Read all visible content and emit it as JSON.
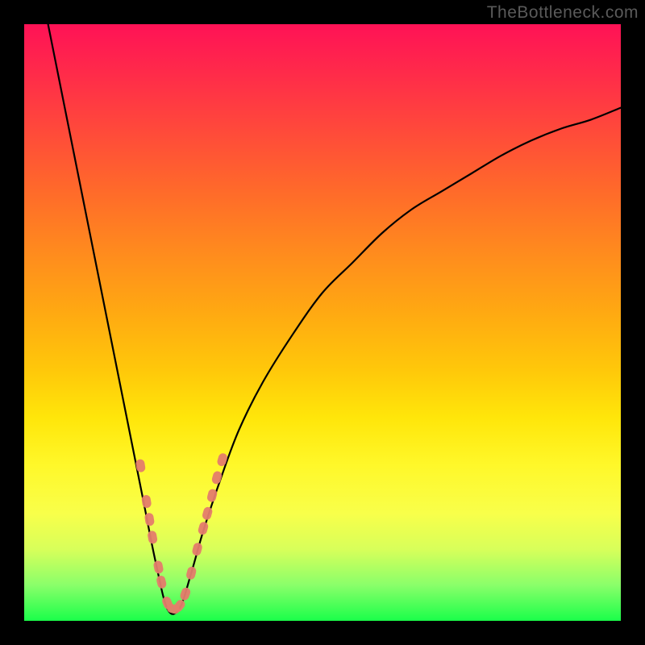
{
  "watermark": "TheBottleneck.com",
  "colors": {
    "background_frame": "#000000",
    "curve_stroke": "#000000",
    "marker_fill": "#e47c6c",
    "marker_stroke": "#e47c6c",
    "gradient_top": "#ff1256",
    "gradient_mid": "#ffe60a",
    "gradient_bottom": "#1aff4a"
  },
  "chart_data": {
    "type": "line",
    "title": "",
    "xlabel": "",
    "ylabel": "",
    "xlim": [
      0,
      100
    ],
    "ylim": [
      0,
      100
    ],
    "legend": false,
    "grid": false,
    "note": "V-shaped bottleneck curve. X = relative component power (arbitrary 0-100), Y = bottleneck severity percent (0 = none, 100 = full). Minimum near x≈24.",
    "series": [
      {
        "name": "bottleneck-curve",
        "values": [
          [
            4,
            100
          ],
          [
            6,
            90
          ],
          [
            8,
            80
          ],
          [
            10,
            70
          ],
          [
            12,
            60
          ],
          [
            14,
            50
          ],
          [
            16,
            40
          ],
          [
            18,
            30
          ],
          [
            20,
            20
          ],
          [
            22,
            10
          ],
          [
            24,
            2
          ],
          [
            26,
            2
          ],
          [
            28,
            8
          ],
          [
            30,
            15
          ],
          [
            33,
            24
          ],
          [
            36,
            32
          ],
          [
            40,
            40
          ],
          [
            45,
            48
          ],
          [
            50,
            55
          ],
          [
            55,
            60
          ],
          [
            60,
            65
          ],
          [
            65,
            69
          ],
          [
            70,
            72
          ],
          [
            75,
            75
          ],
          [
            80,
            78
          ],
          [
            85,
            80.5
          ],
          [
            90,
            82.5
          ],
          [
            95,
            84
          ],
          [
            100,
            86
          ]
        ]
      }
    ],
    "markers": {
      "name": "highlighted-points",
      "note": "Salmon pill-shaped markers clustered near curve bottom on both arms.",
      "values": [
        [
          19.5,
          26
        ],
        [
          20.5,
          20
        ],
        [
          21,
          17
        ],
        [
          21.5,
          14
        ],
        [
          22.5,
          9
        ],
        [
          23,
          6.5
        ],
        [
          24,
          3
        ],
        [
          25,
          2
        ],
        [
          26,
          2.5
        ],
        [
          27,
          4.5
        ],
        [
          28,
          8
        ],
        [
          29,
          12
        ],
        [
          30,
          15.5
        ],
        [
          30.7,
          18
        ],
        [
          31.5,
          21
        ],
        [
          32.3,
          24
        ],
        [
          33.2,
          27
        ]
      ]
    }
  }
}
